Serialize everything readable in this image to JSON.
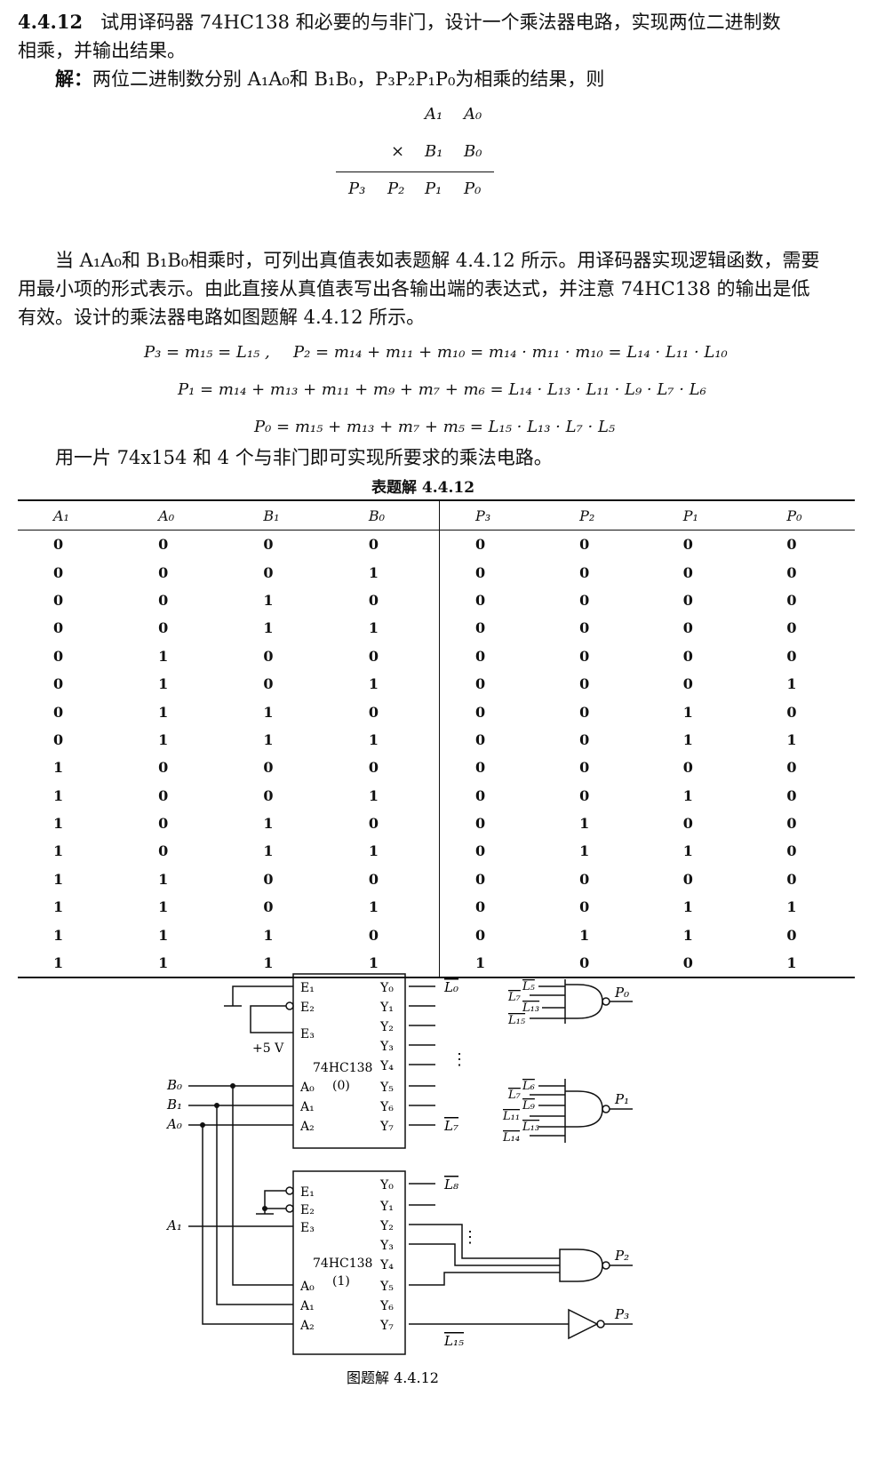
{
  "problem": {
    "number": "4.4.12",
    "statement_line1": "试用译码器 74HC138 和必要的与非门，设计一个乘法器电路，实现两位二进制数",
    "statement_line2": "相乘，并输出结果。",
    "solution_label": "解：",
    "solution_intro": "两位二进制数分别 A₁A₀和 B₁B₀，P₃P₂P₁P₀为相乘的结果，则"
  },
  "multiplication": {
    "row1": [
      "A₁",
      "A₀"
    ],
    "op": "×",
    "row2": [
      "B₁",
      "B₀"
    ],
    "result": [
      "P₃",
      "P₂",
      "P₁",
      "P₀"
    ]
  },
  "paragraph": {
    "line1": "当 A₁A₀和 B₁B₀相乘时，可列出真值表如表题解 4.4.12 所示。用译码器实现逻辑函数，需要",
    "line2": "用最小项的形式表示。由此直接从真值表写出各输出端的表达式，并注意 74HC138 的输出是低",
    "line3": "有效。设计的乘法器电路如图题解 4.4.12 所示。"
  },
  "equations": {
    "p3": "P₃ = m₁₅ = L₁₅ ,",
    "p2": "P₂ = m₁₄ + m₁₁ + m₁₀ = m₁₄ · m₁₁ · m₁₀ = L₁₄ · L₁₁ · L₁₀",
    "p1": "P₁ = m₁₄ + m₁₃ + m₁₁ + m₉ + m₇ + m₆ = L₁₄ · L₁₃ · L₁₁ · L₉ · L₇ · L₆",
    "p0": "P₀ = m₁₅ + m₁₃ + m₇ + m₅ = L₁₅ · L₁₃ · L₇ · L₅"
  },
  "conclusion": "用一片 74x154 和 4 个与非门即可实现所要求的乘法电路。",
  "table": {
    "caption": "表题解 4.4.12",
    "headers": [
      "A₁",
      "A₀",
      "B₁",
      "B₀",
      "P₃",
      "P₂",
      "P₁",
      "P₀"
    ],
    "rows": [
      [
        "0",
        "0",
        "0",
        "0",
        "0",
        "0",
        "0",
        "0"
      ],
      [
        "0",
        "0",
        "0",
        "1",
        "0",
        "0",
        "0",
        "0"
      ],
      [
        "0",
        "0",
        "1",
        "0",
        "0",
        "0",
        "0",
        "0"
      ],
      [
        "0",
        "0",
        "1",
        "1",
        "0",
        "0",
        "0",
        "0"
      ],
      [
        "0",
        "1",
        "0",
        "0",
        "0",
        "0",
        "0",
        "0"
      ],
      [
        "0",
        "1",
        "0",
        "1",
        "0",
        "0",
        "0",
        "1"
      ],
      [
        "0",
        "1",
        "1",
        "0",
        "0",
        "0",
        "1",
        "0"
      ],
      [
        "0",
        "1",
        "1",
        "1",
        "0",
        "0",
        "1",
        "1"
      ],
      [
        "1",
        "0",
        "0",
        "0",
        "0",
        "0",
        "0",
        "0"
      ],
      [
        "1",
        "0",
        "0",
        "1",
        "0",
        "0",
        "1",
        "0"
      ],
      [
        "1",
        "0",
        "1",
        "0",
        "0",
        "1",
        "0",
        "0"
      ],
      [
        "1",
        "0",
        "1",
        "1",
        "0",
        "1",
        "1",
        "0"
      ],
      [
        "1",
        "1",
        "0",
        "0",
        "0",
        "0",
        "0",
        "0"
      ],
      [
        "1",
        "1",
        "0",
        "1",
        "0",
        "0",
        "1",
        "1"
      ],
      [
        "1",
        "1",
        "1",
        "0",
        "0",
        "1",
        "1",
        "0"
      ],
      [
        "1",
        "1",
        "1",
        "1",
        "1",
        "0",
        "0",
        "1"
      ]
    ]
  },
  "circuit": {
    "chip0_name": "74HC138",
    "chip0_index": "(0)",
    "chip1_name": "74HC138",
    "chip1_index": "(1)",
    "supply": "+5 V",
    "enable_pins": [
      "E₁",
      "E₂",
      "E₃"
    ],
    "address_pins": [
      "A₀",
      "A₁",
      "A₂"
    ],
    "output_pins": [
      "Y₀",
      "Y₁",
      "Y₂",
      "Y₃",
      "Y₄",
      "Y₅",
      "Y₆",
      "Y₇"
    ],
    "inputs": [
      "B₀",
      "B₁",
      "A₀",
      "A₁"
    ],
    "chip0_out_labels": [
      "L₀",
      "L₇"
    ],
    "chip1_out_labels": [
      "L₈",
      "L₁₅"
    ],
    "p0_gate_inputs": [
      "L₅",
      "L₇",
      "L₁₃",
      "L₁₅"
    ],
    "p1_gate_inputs": [
      "L₆",
      "L₇",
      "L₉",
      "L₁₁",
      "L₁₃",
      "L₁₄"
    ],
    "gate_outputs": [
      "P₀",
      "P₁",
      "P₂",
      "P₃"
    ],
    "ellipsis": "⋮",
    "caption": "图题解 4.4.12"
  }
}
